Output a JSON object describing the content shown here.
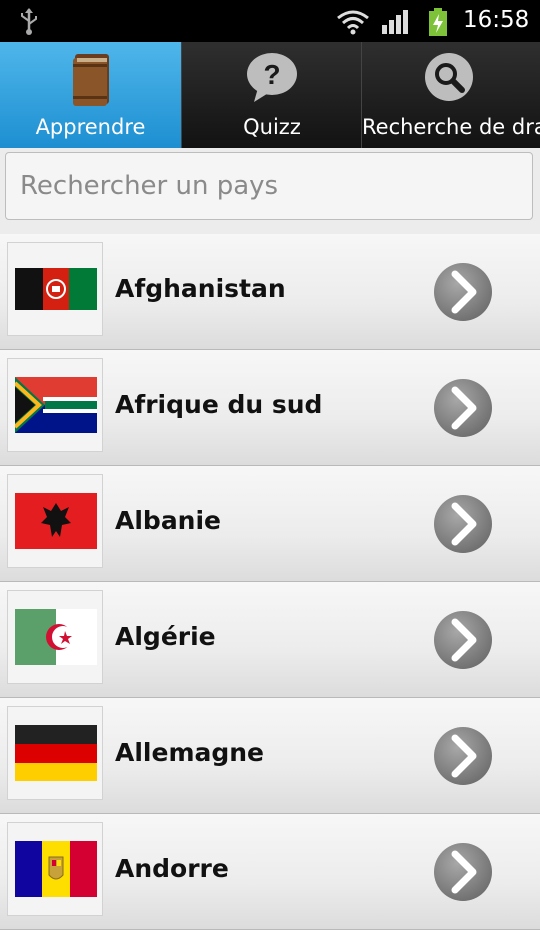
{
  "status_bar": {
    "time": "16:58"
  },
  "tabs": [
    {
      "label": "Apprendre",
      "icon": "book-icon",
      "active": true
    },
    {
      "label": "Quizz",
      "icon": "question-bubble-icon",
      "active": false
    },
    {
      "label": "Recherche de dra",
      "icon": "magnifier-icon",
      "active": false
    }
  ],
  "search": {
    "placeholder": "Rechercher un pays",
    "value": ""
  },
  "countries": [
    {
      "name": "Afghanistan",
      "flag": "afghanistan-flag-icon"
    },
    {
      "name": "Afrique du sud",
      "flag": "south-africa-flag-icon"
    },
    {
      "name": "Albanie",
      "flag": "albania-flag-icon"
    },
    {
      "name": "Algérie",
      "flag": "algeria-flag-icon"
    },
    {
      "name": "Allemagne",
      "flag": "germany-flag-icon"
    },
    {
      "name": "Andorre",
      "flag": "andorra-flag-icon"
    }
  ],
  "colors": {
    "active_tab": "#2a9ddc",
    "tab_bar": "#1c1c1c",
    "list_bg": "#efefef"
  }
}
